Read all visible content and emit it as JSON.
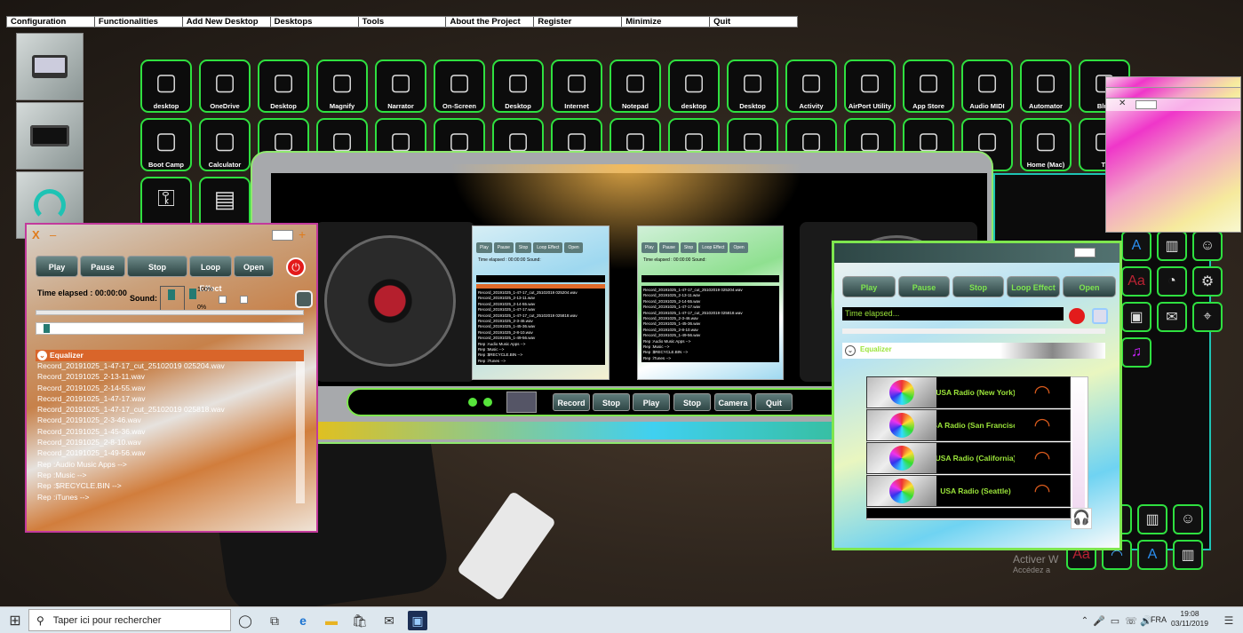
{
  "menu": [
    "Configuration",
    "Functionalities",
    "Add New Desktop",
    "Desktops",
    "Tools",
    "About the Project",
    "Register",
    "Minimize",
    "Quit"
  ],
  "left_tiles": [
    "laptop-icon",
    "dj-controller-icon",
    "headphones-icon"
  ],
  "desktop_icons_row1": [
    "desktop",
    "OneDrive",
    "Desktop",
    "Magnify",
    "Narrator",
    "On-Screen",
    "Desktop",
    "Internet",
    "Notepad",
    "desktop",
    "Desktop",
    "Activity",
    "AirPort Utility",
    "App Store",
    "Audio MIDI",
    "Automator",
    "Blue"
  ],
  "desktop_icons_row2": [
    "Boot Camp",
    "Calculator",
    "",
    "",
    "",
    "",
    "",
    "",
    "",
    "",
    "",
    "",
    "",
    "",
    "",
    "Home (Mac)",
    "Tr"
  ],
  "dj": {
    "controls": [
      "Record",
      "Stop",
      "Play",
      "Stop",
      "Camera",
      "Quit"
    ],
    "mini_left": {
      "buttons": [
        "Play",
        "Pause",
        "Stop",
        "Loop Effect",
        "Open"
      ],
      "elapsed": "Time elapsed : 00:00:00",
      "sound": "Sound:",
      "list": [
        "Record_20191025_1-47-17_cut_25102019 025204.wav",
        "Record_20191025_2-13-11.wav",
        "Record_20191025_2-14-55.wav",
        "Record_20191025_1-47-17.wav",
        "Record_20191025_1-47-17_cut_25102019 025818.wav",
        "Record_20191025_2-3-46.wav",
        "Record_20191025_1-45-36.wav",
        "Record_20191025_2-8-10.wav",
        "Record_20191025_1-49-56.wav",
        "Rep :Audio Music Apps -->",
        "Rep :Music -->",
        "Rep :$RECYCLE.BIN -->",
        "Rep :iTunes -->"
      ]
    },
    "mini_right": {
      "buttons": [
        "Play",
        "Pause",
        "Stop",
        "Loop Effect",
        "Open"
      ],
      "elapsed": "Time elapsed : 00:00:00",
      "sound": "Sound:"
    }
  },
  "left_player": {
    "close": "X",
    "min": "–",
    "buttons": [
      "Play",
      "Pause",
      "Stop",
      "Loop Effect",
      "Open"
    ],
    "elapsed": "Time elapsed : 00:00:00",
    "sound": "Sound:",
    "vol_max": "100%",
    "vol_min": "0%",
    "equalizer": "Equalizer",
    "files": [
      "Record_20191025_1-47-17_cut_25102019 025204.wav",
      "Record_20191025_2-13-11.wav",
      "Record_20191025_2-14-55.wav",
      "Record_20191025_1-47-17.wav",
      "Record_20191025_1-47-17_cut_25102019 025818.wav",
      "Record_20191025_2-3-46.wav",
      "Record_20191025_1-45-36.wav",
      "Record_20191025_2-8-10.wav",
      "Record_20191025_1-49-56.wav",
      "Rep :Audio Music Apps -->",
      "Rep :Music -->",
      "Rep :$RECYCLE.BIN -->",
      "Rep :iTunes -->"
    ]
  },
  "radio": {
    "buttons": [
      "Play",
      "Pause",
      "Stop",
      "Loop Effect",
      "Open"
    ],
    "elapsed": "Time elapsed...",
    "equalizer": "Equalizer",
    "stations": [
      "USA Radio (New York)",
      "USA Radio (San Francisco)",
      "USA Radio (California)",
      "USA Radio (Seattle)"
    ]
  },
  "watermark": {
    "line1": "Activer W",
    "line2": "Accédez a"
  },
  "taskbar": {
    "search_placeholder": "Taper ici pour rechercher",
    "lang": "FRA",
    "time": "19:08",
    "date": "03/11/2019"
  },
  "colors": {
    "accent_green": "#7ee64f",
    "record_red": "#e31b1b",
    "equalizer_orange": "#d96a2a"
  }
}
